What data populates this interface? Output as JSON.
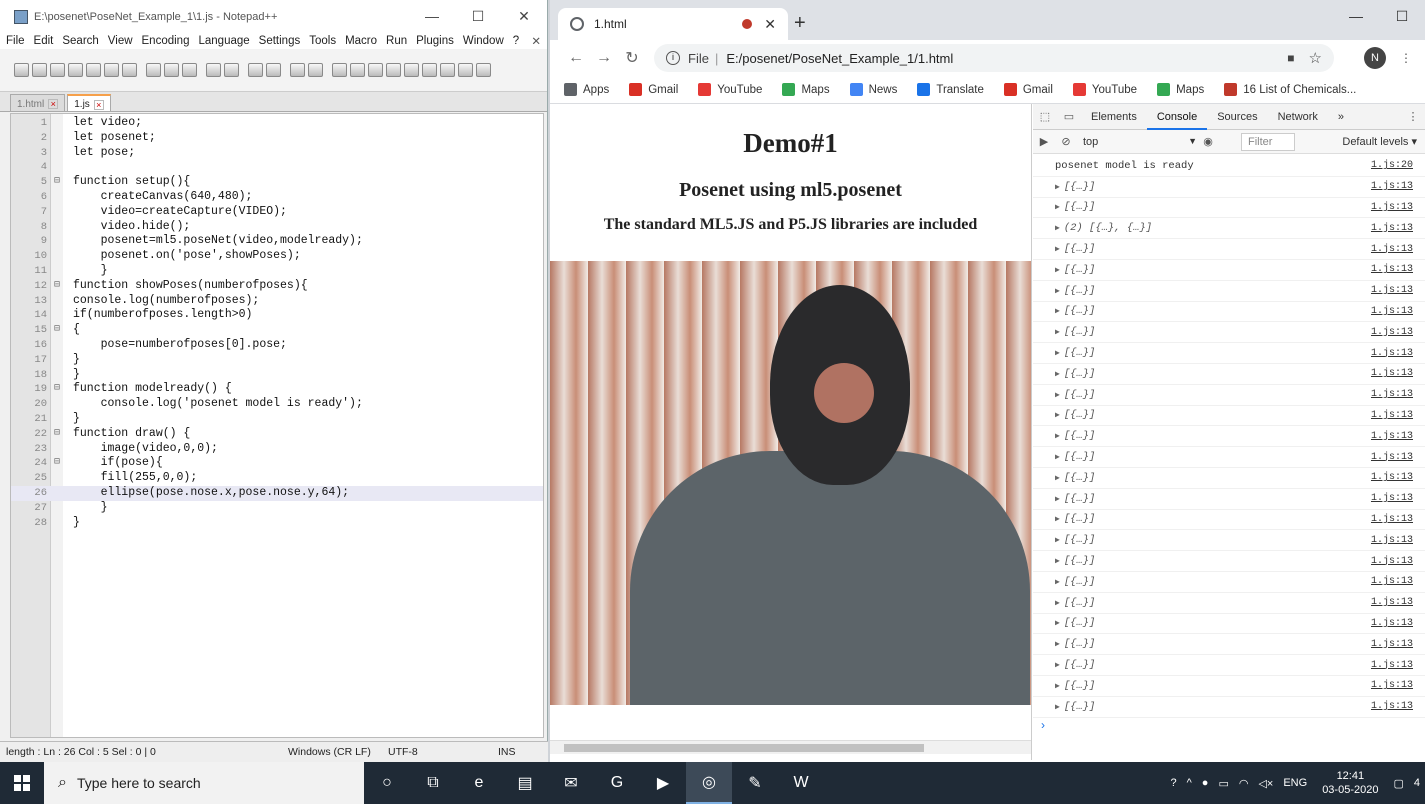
{
  "notepad": {
    "title": "E:\\posenet\\PoseNet_Example_1\\1.js - Notepad++",
    "menu": [
      "File",
      "Edit",
      "Search",
      "View",
      "Encoding",
      "Language",
      "Settings",
      "Tools",
      "Macro",
      "Run",
      "Plugins",
      "Window",
      "?"
    ],
    "tabs": [
      {
        "label": "1.html",
        "active": false
      },
      {
        "label": "1.js",
        "active": true
      }
    ],
    "code": [
      {
        "n": "1",
        "fold": "",
        "text": "let video;"
      },
      {
        "n": "2",
        "fold": "",
        "text": "let posenet;"
      },
      {
        "n": "3",
        "fold": "",
        "text": "let pose;"
      },
      {
        "n": "4",
        "fold": "",
        "text": ""
      },
      {
        "n": "5",
        "fold": "⊟",
        "text": "function setup(){"
      },
      {
        "n": "6",
        "fold": "",
        "text": "    createCanvas(640,480);"
      },
      {
        "n": "7",
        "fold": "",
        "text": "    video=createCapture(VIDEO);"
      },
      {
        "n": "8",
        "fold": "",
        "text": "    video.hide();"
      },
      {
        "n": "9",
        "fold": "",
        "text": "    posenet=ml5.poseNet(video,modelready);"
      },
      {
        "n": "10",
        "fold": "",
        "text": "    posenet.on('pose',showPoses);"
      },
      {
        "n": "11",
        "fold": "",
        "text": "    }"
      },
      {
        "n": "12",
        "fold": "⊟",
        "text": "function showPoses(numberofposes){"
      },
      {
        "n": "13",
        "fold": "",
        "text": "console.log(numberofposes);"
      },
      {
        "n": "14",
        "fold": "",
        "text": "if(numberofposes.length>0)"
      },
      {
        "n": "15",
        "fold": "⊟",
        "text": "{"
      },
      {
        "n": "16",
        "fold": "",
        "text": "    pose=numberofposes[0].pose;"
      },
      {
        "n": "17",
        "fold": "",
        "text": "}"
      },
      {
        "n": "18",
        "fold": "",
        "text": "}"
      },
      {
        "n": "19",
        "fold": "⊟",
        "text": "function modelready() {"
      },
      {
        "n": "20",
        "fold": "",
        "text": "    console.log('posenet model is ready');"
      },
      {
        "n": "21",
        "fold": "",
        "text": "}"
      },
      {
        "n": "22",
        "fold": "⊟",
        "text": "function draw() {"
      },
      {
        "n": "23",
        "fold": "",
        "text": "    image(video,0,0);"
      },
      {
        "n": "24",
        "fold": "⊟",
        "text": "    if(pose){"
      },
      {
        "n": "25",
        "fold": "",
        "text": "    fill(255,0,0);"
      },
      {
        "n": "26",
        "fold": "",
        "text": "    ellipse(pose.nose.x,pose.nose.y,64);"
      },
      {
        "n": "27",
        "fold": "",
        "text": "    }"
      },
      {
        "n": "28",
        "fold": "",
        "text": "}"
      }
    ],
    "current_line": "26",
    "status": {
      "length": "length : Ln : 26    Col : 5    Sel : 0 | 0",
      "eol": "Windows (CR LF)",
      "encoding": "UTF-8",
      "mode": "INS"
    }
  },
  "chrome": {
    "tab_title": "1.html",
    "new_tab": "+",
    "omnibox": {
      "scheme": "File",
      "divider": "|",
      "url": "E:/posenet/PoseNet_Example_1/1.html"
    },
    "avatar": "N",
    "bookmarks": [
      {
        "label": "Apps",
        "color": "#5f6368"
      },
      {
        "label": "Gmail",
        "color": "#d93025"
      },
      {
        "label": "YouTube",
        "color": "#e53935"
      },
      {
        "label": "Maps",
        "color": "#34a853"
      },
      {
        "label": "News",
        "color": "#4285f4"
      },
      {
        "label": "Translate",
        "color": "#1a73e8"
      },
      {
        "label": "Gmail",
        "color": "#d93025"
      },
      {
        "label": "YouTube",
        "color": "#e53935"
      },
      {
        "label": "Maps",
        "color": "#34a853"
      },
      {
        "label": "16 List of Chemicals...",
        "color": "#c0392b"
      }
    ]
  },
  "page": {
    "h1": "Demo#1",
    "h2": "Posenet using ml5.posenet",
    "h3": "The standard ML5.JS and P5.JS libraries are included"
  },
  "devtools": {
    "tabs": [
      "Elements",
      "Console",
      "Sources",
      "Network"
    ],
    "active_tab": "Console",
    "more": "»",
    "context": "top",
    "filter_placeholder": "Filter",
    "levels": "Default levels ▾",
    "logs": [
      {
        "msg": "posenet model is ready",
        "src": "1.js:20",
        "type": "text"
      },
      {
        "msg": "[{…}]",
        "src": "1.js:13",
        "type": "obj"
      },
      {
        "msg": "[{…}]",
        "src": "1.js:13",
        "type": "obj"
      },
      {
        "msg": "(2) [{…}, {…}]",
        "src": "1.js:13",
        "type": "obj"
      },
      {
        "msg": "[{…}]",
        "src": "1.js:13",
        "type": "obj"
      },
      {
        "msg": "[{…}]",
        "src": "1.js:13",
        "type": "obj"
      },
      {
        "msg": "[{…}]",
        "src": "1.js:13",
        "type": "obj"
      },
      {
        "msg": "[{…}]",
        "src": "1.js:13",
        "type": "obj"
      },
      {
        "msg": "[{…}]",
        "src": "1.js:13",
        "type": "obj"
      },
      {
        "msg": "[{…}]",
        "src": "1.js:13",
        "type": "obj"
      },
      {
        "msg": "[{…}]",
        "src": "1.js:13",
        "type": "obj"
      },
      {
        "msg": "[{…}]",
        "src": "1.js:13",
        "type": "obj"
      },
      {
        "msg": "[{…}]",
        "src": "1.js:13",
        "type": "obj"
      },
      {
        "msg": "[{…}]",
        "src": "1.js:13",
        "type": "obj"
      },
      {
        "msg": "[{…}]",
        "src": "1.js:13",
        "type": "obj"
      },
      {
        "msg": "[{…}]",
        "src": "1.js:13",
        "type": "obj"
      },
      {
        "msg": "[{…}]",
        "src": "1.js:13",
        "type": "obj"
      },
      {
        "msg": "[{…}]",
        "src": "1.js:13",
        "type": "obj"
      },
      {
        "msg": "[{…}]",
        "src": "1.js:13",
        "type": "obj"
      },
      {
        "msg": "[{…}]",
        "src": "1.js:13",
        "type": "obj"
      },
      {
        "msg": "[{…}]",
        "src": "1.js:13",
        "type": "obj"
      },
      {
        "msg": "[{…}]",
        "src": "1.js:13",
        "type": "obj"
      },
      {
        "msg": "[{…}]",
        "src": "1.js:13",
        "type": "obj"
      },
      {
        "msg": "[{…}]",
        "src": "1.js:13",
        "type": "obj"
      },
      {
        "msg": "[{…}]",
        "src": "1.js:13",
        "type": "obj"
      },
      {
        "msg": "[{…}]",
        "src": "1.js:13",
        "type": "obj"
      },
      {
        "msg": "[{…}]",
        "src": "1.js:13",
        "type": "obj"
      }
    ],
    "prompt": "›"
  },
  "taskbar": {
    "search_placeholder": "Type here to search",
    "lang": "ENG",
    "time": "12:41",
    "date": "03-05-2020",
    "notifications": "4"
  }
}
